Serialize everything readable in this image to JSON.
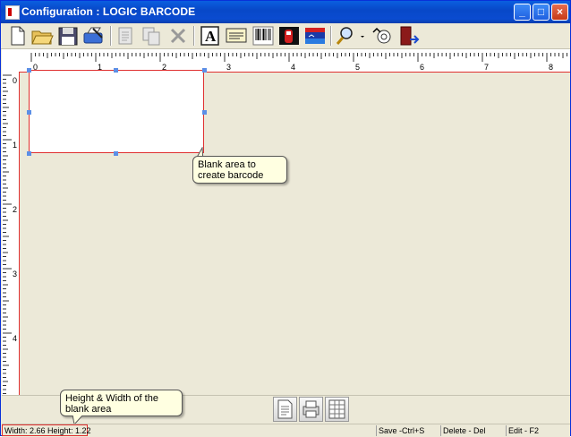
{
  "window": {
    "title": "Configuration : LOGIC BARCODE",
    "minimize_label": "_",
    "maximize_label": "□",
    "close_label": "×"
  },
  "toolbar": {
    "tools": [
      {
        "name": "new-icon"
      },
      {
        "name": "open-folder-icon"
      },
      {
        "name": "save-disk-icon"
      },
      {
        "name": "print-setup-icon"
      },
      {
        "name": "copy-icon"
      },
      {
        "name": "duplicate-icon"
      },
      {
        "name": "delete-icon"
      },
      {
        "name": "text-tool-icon"
      },
      {
        "name": "label-tool-icon"
      },
      {
        "name": "barcode-tool-icon"
      },
      {
        "name": "graphic-tool-icon"
      },
      {
        "name": "image-tool-icon"
      },
      {
        "name": "zoom-icon"
      },
      {
        "name": "hand-pan-icon"
      },
      {
        "name": "exit-door-icon"
      }
    ]
  },
  "ruler": {
    "top_labels": [
      "0",
      "1",
      "2",
      "3",
      "4",
      "5",
      "6",
      "7",
      "8"
    ],
    "left_labels": [
      "0",
      "1",
      "2",
      "3",
      "4"
    ]
  },
  "callouts": {
    "blank_area": "Blank area to create barcode",
    "dimensions": "Height & Width of the blank area"
  },
  "bottom_buttons": [
    {
      "name": "page-view-icon"
    },
    {
      "name": "print-preview-icon"
    },
    {
      "name": "grid-view-icon"
    }
  ],
  "status": {
    "dimensions": "Width: 2.66 Height: 1.22",
    "save": "Save -Ctrl+S",
    "delete": "Delete - Del",
    "edit": "Edit - F2"
  },
  "colors": {
    "titlebar": "#0A4BD0",
    "window_bg": "#ECE9D8",
    "guide_red": "#E03030",
    "handle_blue": "#5C8FE6",
    "tooltip_bg": "#FFFFE1"
  }
}
